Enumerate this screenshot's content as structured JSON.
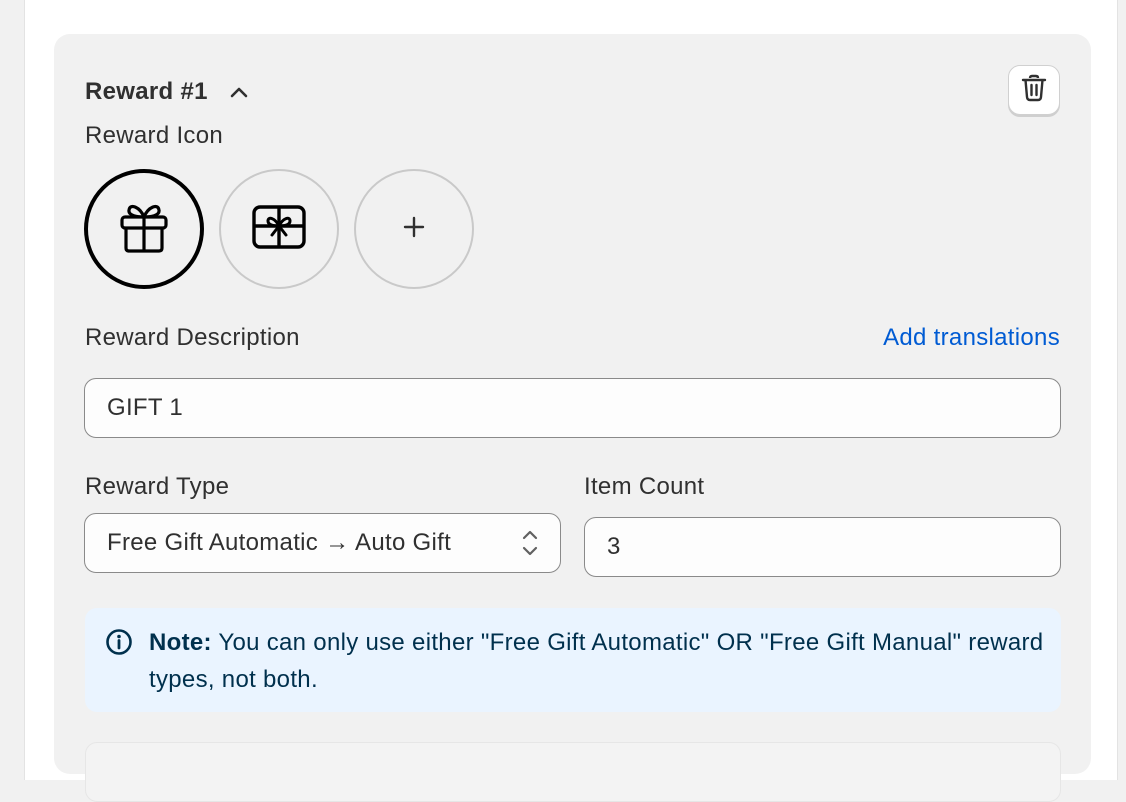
{
  "reward": {
    "title": "Reward #1",
    "icon_label": "Reward Icon",
    "icons": [
      {
        "name": "gift-icon",
        "selected": true
      },
      {
        "name": "gift-card-icon",
        "selected": false
      },
      {
        "name": "plus-icon",
        "selected": false,
        "glyph": "+"
      }
    ],
    "description_label": "Reward Description",
    "add_translations": "Add translations",
    "description_value": "GIFT 1",
    "type_label": "Reward Type",
    "type_value": "Free Gift Automatic → Auto Gift",
    "count_label": "Item Count",
    "count_value": "3",
    "note_bold": "Note:",
    "note_text": " You can only use either \"Free Gift Automatic\" OR \"Free Gift Manual\" reward types, not both."
  },
  "colors": {
    "link": "#005bd3",
    "note_bg": "#eaf4ff",
    "note_text": "#00304d",
    "card_bg": "#f1f1f1"
  }
}
